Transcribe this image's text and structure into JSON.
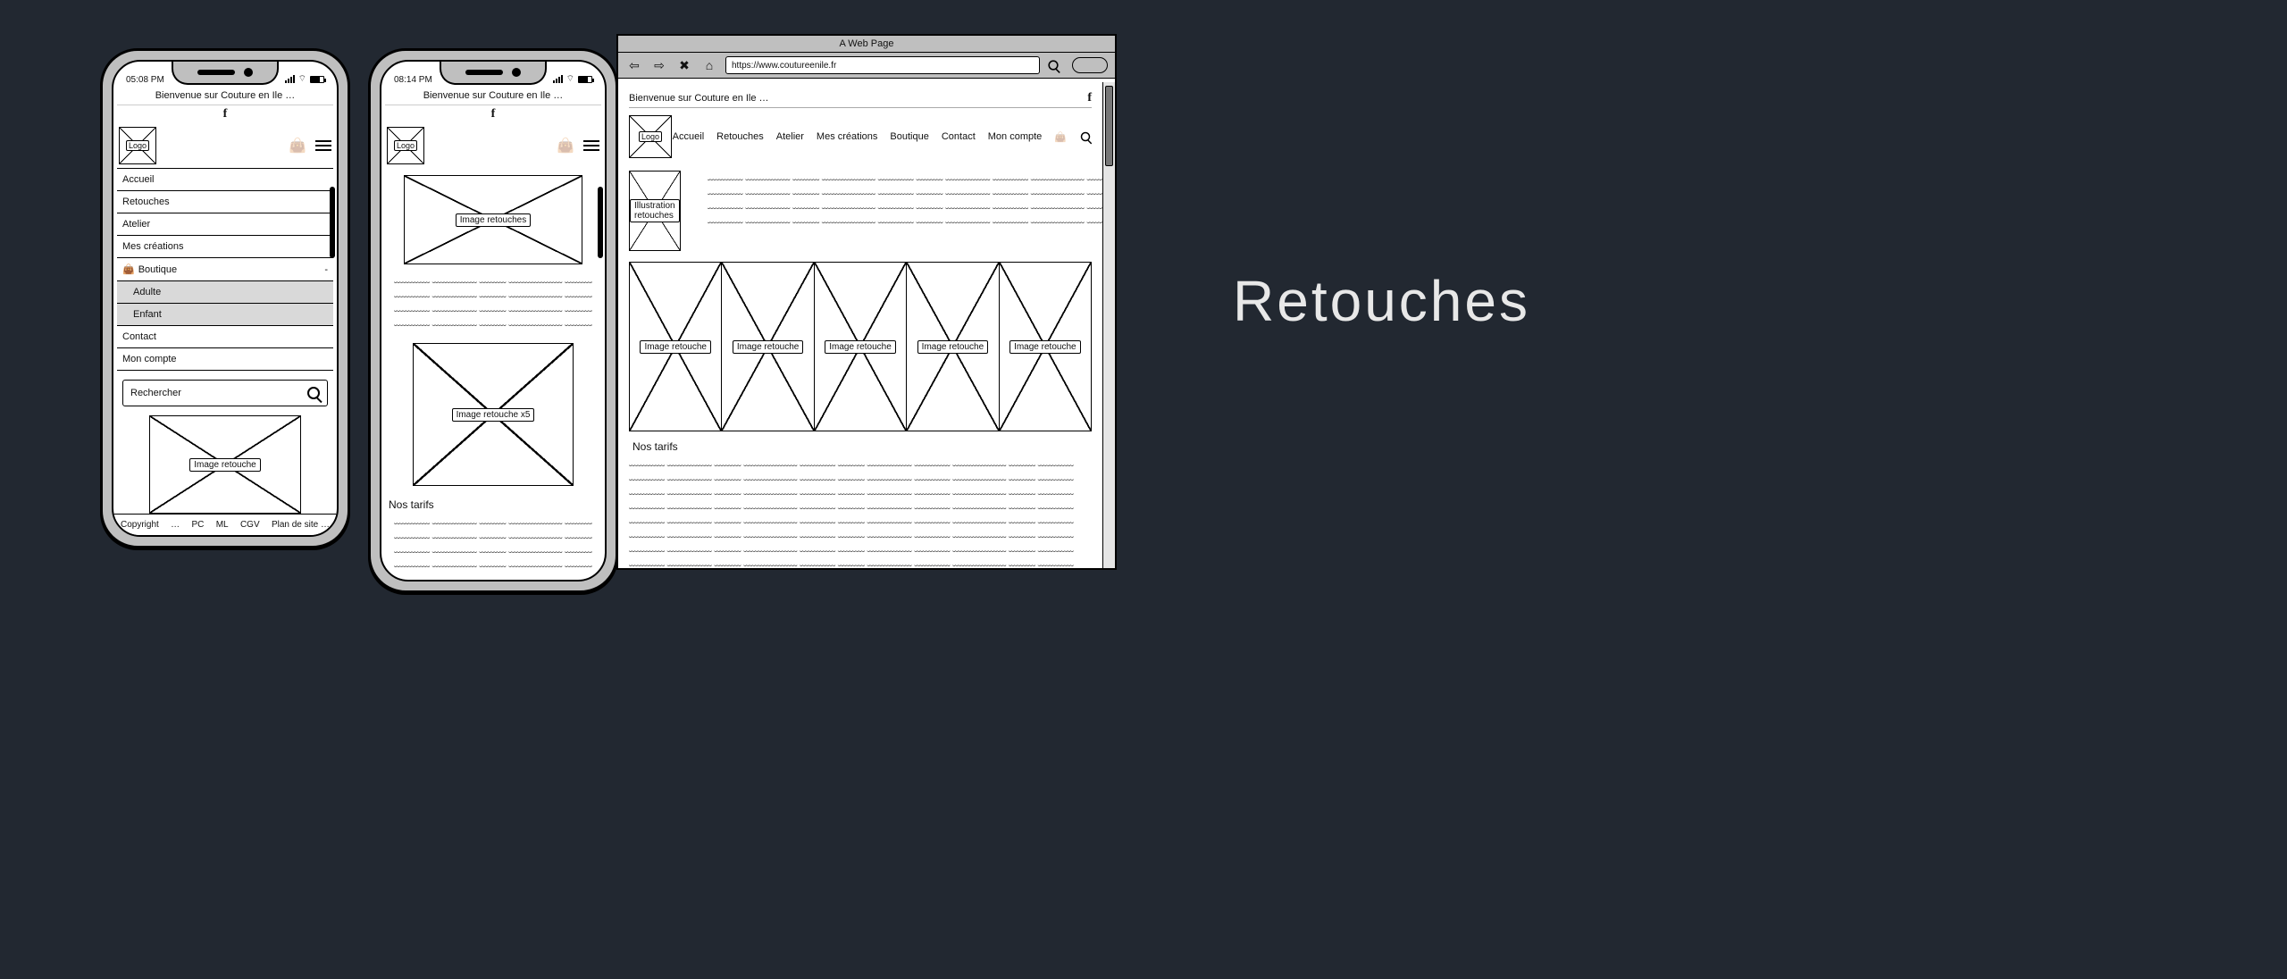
{
  "sideLabel": "Retouches",
  "welcome": "Bienvenue sur Couture en Ile …",
  "url": "https://www.coutureenile.fr",
  "browserTitle": "A Web Page",
  "logo": "Logo",
  "statusbar": {
    "t1": "05:08 PM",
    "t2": "08:14 PM",
    "wifi": "⌔"
  },
  "nav": {
    "items": [
      "Accueil",
      "Retouches",
      "Atelier",
      "Mes créations",
      "Boutique",
      "Contact",
      "Mon compte"
    ],
    "sub": [
      "Adulte",
      "Enfant"
    ]
  },
  "search": {
    "placeholder": "Rechercher"
  },
  "footer": {
    "copyright": "Copyright",
    "dots": "…",
    "pc": "PC",
    "ml": "ML",
    "cgv": "CGV",
    "plan": "Plan de site …"
  },
  "images": {
    "retouche": "Image retouche",
    "retouches": "Image retouches",
    "retouchex5": "Image retouche x5",
    "illustration": "Illustration retouches"
  },
  "tarifs": "Nos tarifs",
  "filler": "﹏﹏﹏﹏ ﹏﹏﹏﹏﹏ ﹏﹏﹏ ﹏﹏﹏﹏﹏﹏ ﹏﹏﹏﹏ ﹏﹏﹏ ﹏﹏﹏﹏﹏ ﹏﹏﹏﹏ ﹏﹏﹏﹏﹏﹏ ﹏﹏﹏ ﹏﹏﹏﹏"
}
